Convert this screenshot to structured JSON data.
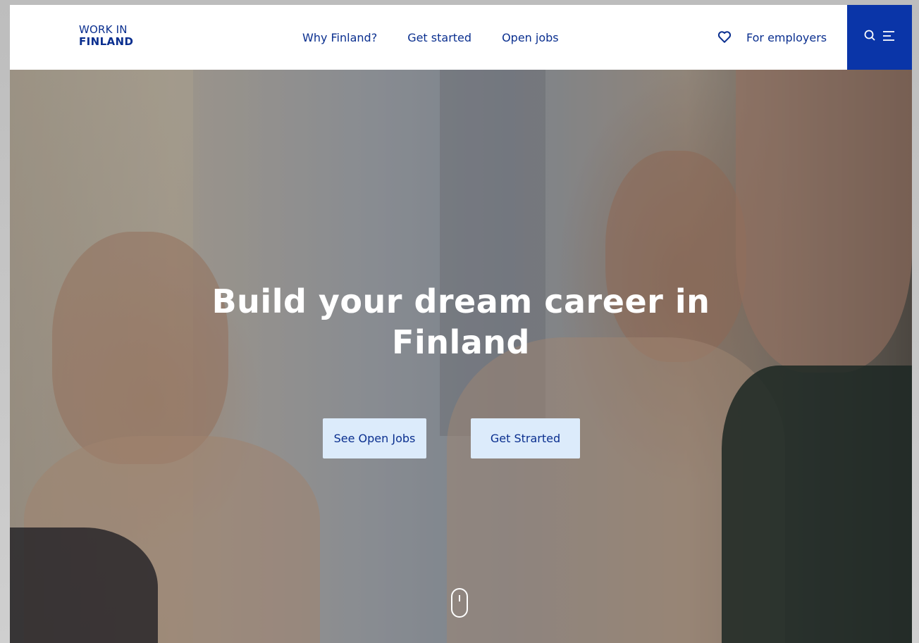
{
  "header": {
    "logo": {
      "line1": "WORK IN",
      "line2": "FINLAND"
    },
    "nav": [
      {
        "label": "Why Finland?"
      },
      {
        "label": "Get started"
      },
      {
        "label": "Open jobs"
      }
    ],
    "favorites_icon": "heart-outline-icon",
    "employers_label": "For employers",
    "menu_icons": [
      "search-icon",
      "menu-icon"
    ],
    "brand_color": "#0a2f8f",
    "menu_bg_color": "#0a35a8"
  },
  "hero": {
    "title_line1": "Build your dream career in",
    "title_line2": "Finland",
    "buttons": [
      {
        "label": "See Open Jobs"
      },
      {
        "label": "Get Strarted"
      }
    ],
    "button_bg_color": "#dcebfb",
    "scroll_indicator": "mouse-scroll-icon"
  }
}
